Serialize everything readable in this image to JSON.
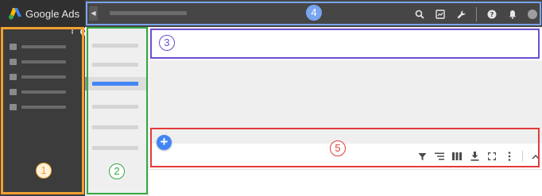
{
  "app": {
    "logo_text": "Google Ads"
  },
  "left_nav": {
    "items": [
      {
        "icon": "search-icon"
      },
      {
        "icon": "table-icon"
      },
      {
        "icon": "tag-icon"
      },
      {
        "icon": "video-icon"
      },
      {
        "icon": "info-icon"
      }
    ]
  },
  "header": {
    "collapse_glyph": "◀",
    "icons": [
      "search-icon",
      "reports-icon",
      "tools-icon",
      "help-icon",
      "notifications-icon",
      "account-avatar"
    ]
  },
  "content": {
    "add_button_glyph": "+"
  },
  "table_toolbar": {
    "icons": [
      "filter-icon",
      "segment-icon",
      "columns-icon",
      "download-icon",
      "expand-icon",
      "more-icon",
      "collapse-icon"
    ]
  },
  "callouts": {
    "c1": "1",
    "c2": "2",
    "c3": "3",
    "c4": "4",
    "c5": "5"
  },
  "colors": {
    "callout_1": "#f0a030",
    "callout_2": "#36a845",
    "callout_3": "#6b4fd0",
    "callout_4": "#78a4f0",
    "callout_5": "#e23b3b",
    "accent": "#4285f4"
  }
}
